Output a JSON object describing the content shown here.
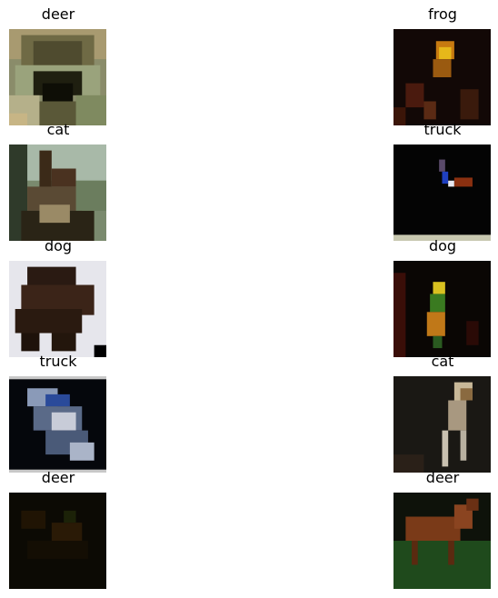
{
  "figure": {
    "tiles": [
      {
        "label": "deer",
        "image": "frog-closeup-icon"
      },
      {
        "label": "frog",
        "image": "dark-scene-yellow-object-icon"
      },
      {
        "label": "cat",
        "image": "deer-in-forest-icon"
      },
      {
        "label": "truck",
        "image": "dark-scene-small-figure-icon"
      },
      {
        "label": "dog",
        "image": "dark-animal-on-white-icon"
      },
      {
        "label": "dog",
        "image": "parrot-on-dark-icon"
      },
      {
        "label": "truck",
        "image": "car-toy-dark-icon"
      },
      {
        "label": "cat",
        "image": "dog-silhouette-dark-icon"
      },
      {
        "label": "deer",
        "image": "very-dark-scene-icon"
      },
      {
        "label": "deer",
        "image": "horse-on-grass-icon"
      }
    ]
  }
}
